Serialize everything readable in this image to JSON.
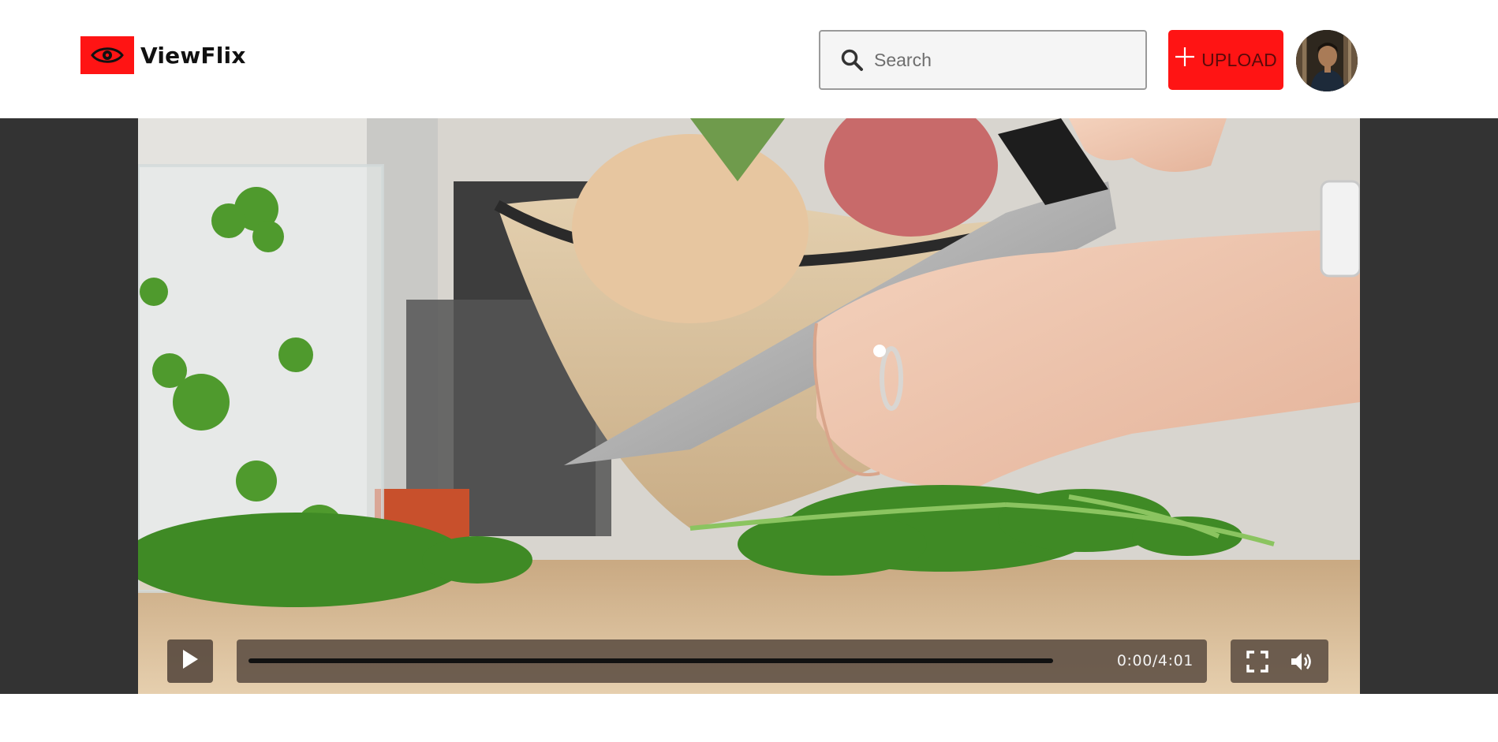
{
  "app": {
    "name": "ViewFlix",
    "brand_color": "#ff1414"
  },
  "header": {
    "logo_icon": "eye-icon",
    "search": {
      "icon": "search-icon",
      "placeholder": "Search",
      "value": ""
    },
    "upload": {
      "icon": "plus-icon",
      "label": "UPLOAD"
    },
    "avatar": {
      "icon": "user-avatar"
    }
  },
  "player": {
    "play_icon": "play-icon",
    "time_display": "0:00/4:01",
    "progress_fraction": 0,
    "fullscreen_icon": "fullscreen-icon",
    "volume_icon": "volume-icon"
  }
}
